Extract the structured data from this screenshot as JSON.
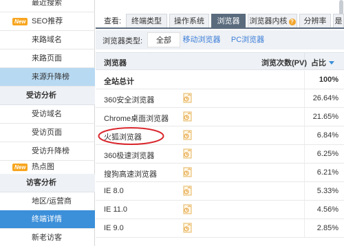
{
  "sidebar": {
    "items": [
      {
        "label": "最近搜索",
        "kind": "sub"
      },
      {
        "label": "SEO推荐",
        "kind": "new",
        "badge": "New"
      },
      {
        "label": "来路域名",
        "kind": "sub"
      },
      {
        "label": "来路页面",
        "kind": "sub"
      },
      {
        "label": "来源升降榜",
        "kind": "highlight"
      },
      {
        "label": "受访分析",
        "kind": "section"
      },
      {
        "label": "受访域名",
        "kind": "sub"
      },
      {
        "label": "受访页面",
        "kind": "sub"
      },
      {
        "label": "受访升降榜",
        "kind": "sub"
      },
      {
        "label": "热点图",
        "kind": "new",
        "badge": "New"
      },
      {
        "label": "访客分析",
        "kind": "section"
      },
      {
        "label": "地区/运营商",
        "kind": "sub"
      },
      {
        "label": "终端详情",
        "kind": "active"
      },
      {
        "label": "新老访客",
        "kind": "sub"
      }
    ]
  },
  "tabs": {
    "label": "查看:",
    "items": [
      {
        "label": "终端类型",
        "active": false
      },
      {
        "label": "操作系统",
        "active": false
      },
      {
        "label": "浏览器",
        "active": true
      },
      {
        "label": "浏览器内核",
        "active": false,
        "help": "?"
      },
      {
        "label": "分辨率",
        "active": false
      },
      {
        "label": "是",
        "active": false
      }
    ]
  },
  "filter": {
    "label": "浏览器类型:",
    "options": [
      {
        "label": "全部",
        "selected": true
      },
      {
        "label": "移动浏览器",
        "selected": false
      },
      {
        "label": "PC浏览器",
        "selected": false
      }
    ]
  },
  "table": {
    "headers": {
      "name": "浏览器",
      "views": "浏览次数(PV)",
      "pct": "占比"
    },
    "total": {
      "name": "全站总计",
      "pct": "100%"
    },
    "rows": [
      {
        "name": "360安全浏览器",
        "pct": "26.64%"
      },
      {
        "name": "Chrome桌面浏览器",
        "pct": "21.65%"
      },
      {
        "name": "火狐浏览器",
        "pct": "6.84%"
      },
      {
        "name": "360极速浏览器",
        "pct": "6.25%"
      },
      {
        "name": "搜狗高速浏览器",
        "pct": "6.21%"
      },
      {
        "name": "IE 8.0",
        "pct": "5.33%"
      },
      {
        "name": "IE 11.0",
        "pct": "4.56%"
      },
      {
        "name": "IE 9.0",
        "pct": "2.85%"
      }
    ]
  },
  "colors": {
    "accent": "#3c8fd9",
    "annotation": "#d9262c",
    "tab_active": "#5a6b7d",
    "new_badge": "#f7a51e"
  },
  "icons": {
    "row_action": "trend-chart-icon",
    "annotation": "red-ellipse-highlight"
  }
}
